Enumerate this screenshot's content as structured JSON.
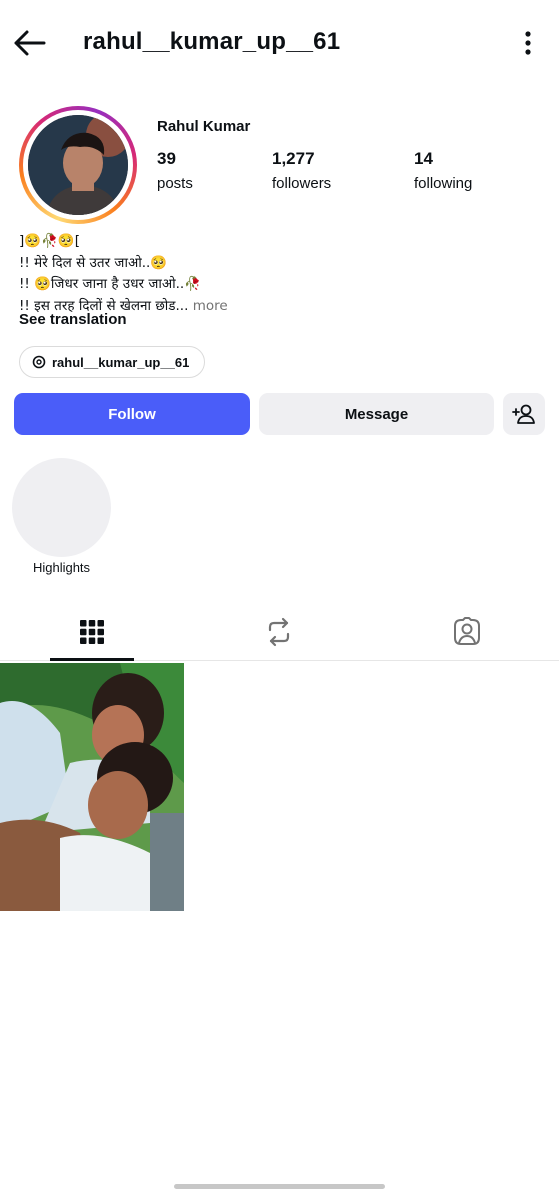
{
  "header": {
    "username": "rahul__kumar_up__61",
    "back_icon": "arrow-left-icon",
    "more_icon": "kebab-menu-icon"
  },
  "profile": {
    "full_name": "Rahul Kumar",
    "stats": [
      {
        "value": "39",
        "label": "posts"
      },
      {
        "value": "1,277",
        "label": "followers"
      },
      {
        "value": "14",
        "label": "following"
      }
    ],
    "bio_lines": [
      "]🥺🥀🥺[",
      "!! मेरे दिल से उतर जाओ..🥺",
      "!! 🥺जिधर जाना है उधर जाओ..🥀",
      "!! इस तरह दिलों से खेलना छोड..."
    ],
    "bio_more": " more",
    "see_translation": "See translation",
    "threads_handle": "rahul__kumar_up__61"
  },
  "actions": {
    "follow_label": "Follow",
    "message_label": "Message"
  },
  "highlights": [
    {
      "label": "Highlights"
    }
  ],
  "tabs": [
    {
      "icon": "grid-icon",
      "active": true
    },
    {
      "icon": "reels-repost-icon",
      "active": false
    },
    {
      "icon": "tagged-person-icon",
      "active": false
    }
  ],
  "colors": {
    "follow_button": "#4a5df9",
    "secondary_button": "#efeff2",
    "muted_text": "#737373"
  }
}
